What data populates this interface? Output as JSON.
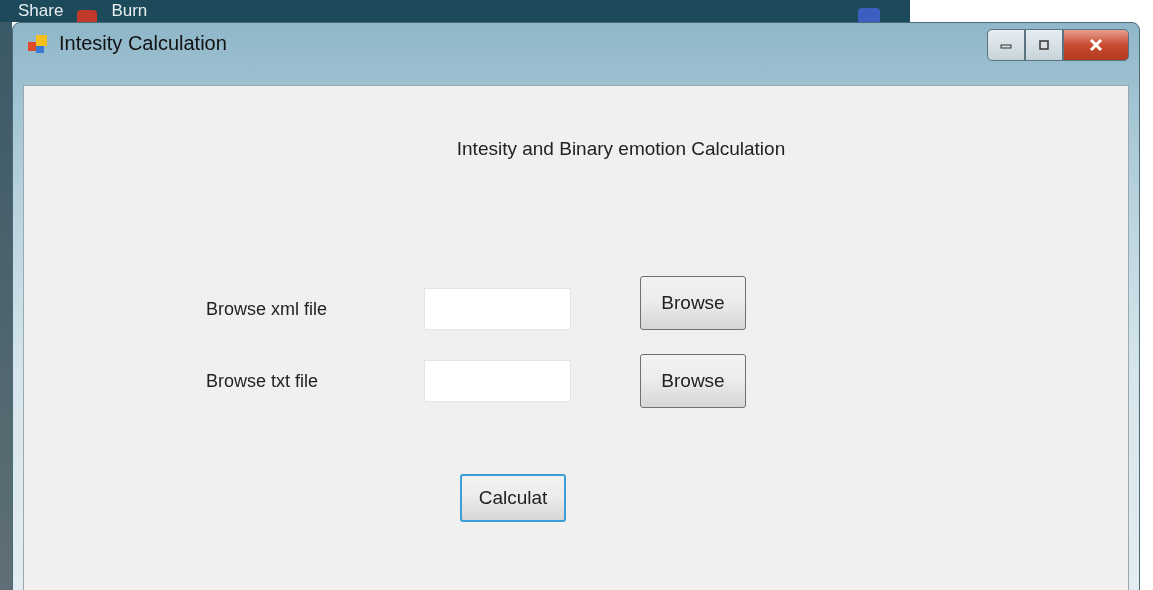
{
  "background_window": {
    "toolbar": [
      "Share",
      "Burn"
    ]
  },
  "window": {
    "title": "Intesity Calculation"
  },
  "heading": "Intesity and Binary emotion Calculation",
  "rows": [
    {
      "label": "Browse xml file",
      "button": "Browse"
    },
    {
      "label": "Browse txt file",
      "button": "Browse"
    }
  ],
  "action_button": {
    "label": "Calculat",
    "focused": true
  }
}
